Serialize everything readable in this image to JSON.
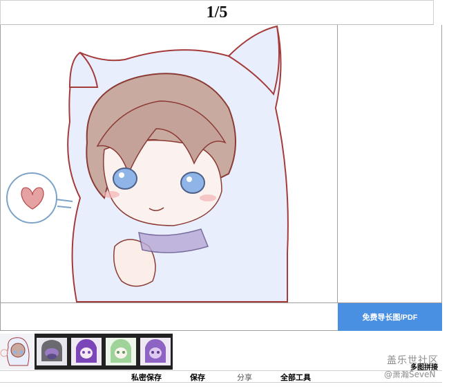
{
  "header": {
    "page_counter": "1/5"
  },
  "viewer": {
    "image_description_icon": "chibi-catgirl-illustration"
  },
  "side": {
    "export_label": "免费导长图/PDF"
  },
  "thumbnails": [
    {
      "label": "thumbnail-1",
      "active": true
    },
    {
      "label": "thumbnail-2",
      "active": false
    },
    {
      "label": "thumbnail-3",
      "active": false
    },
    {
      "label": "thumbnail-4",
      "active": false
    },
    {
      "label": "thumbnail-5",
      "active": false
    }
  ],
  "toolbar": {
    "private_save": "私密保存",
    "save": "保存",
    "share": "分享",
    "all_tools": "全部工具",
    "multi_stitch": "多图拼接"
  },
  "watermark": {
    "line1": "盖乐世社区",
    "line2": "@萧瀚SeveN"
  }
}
